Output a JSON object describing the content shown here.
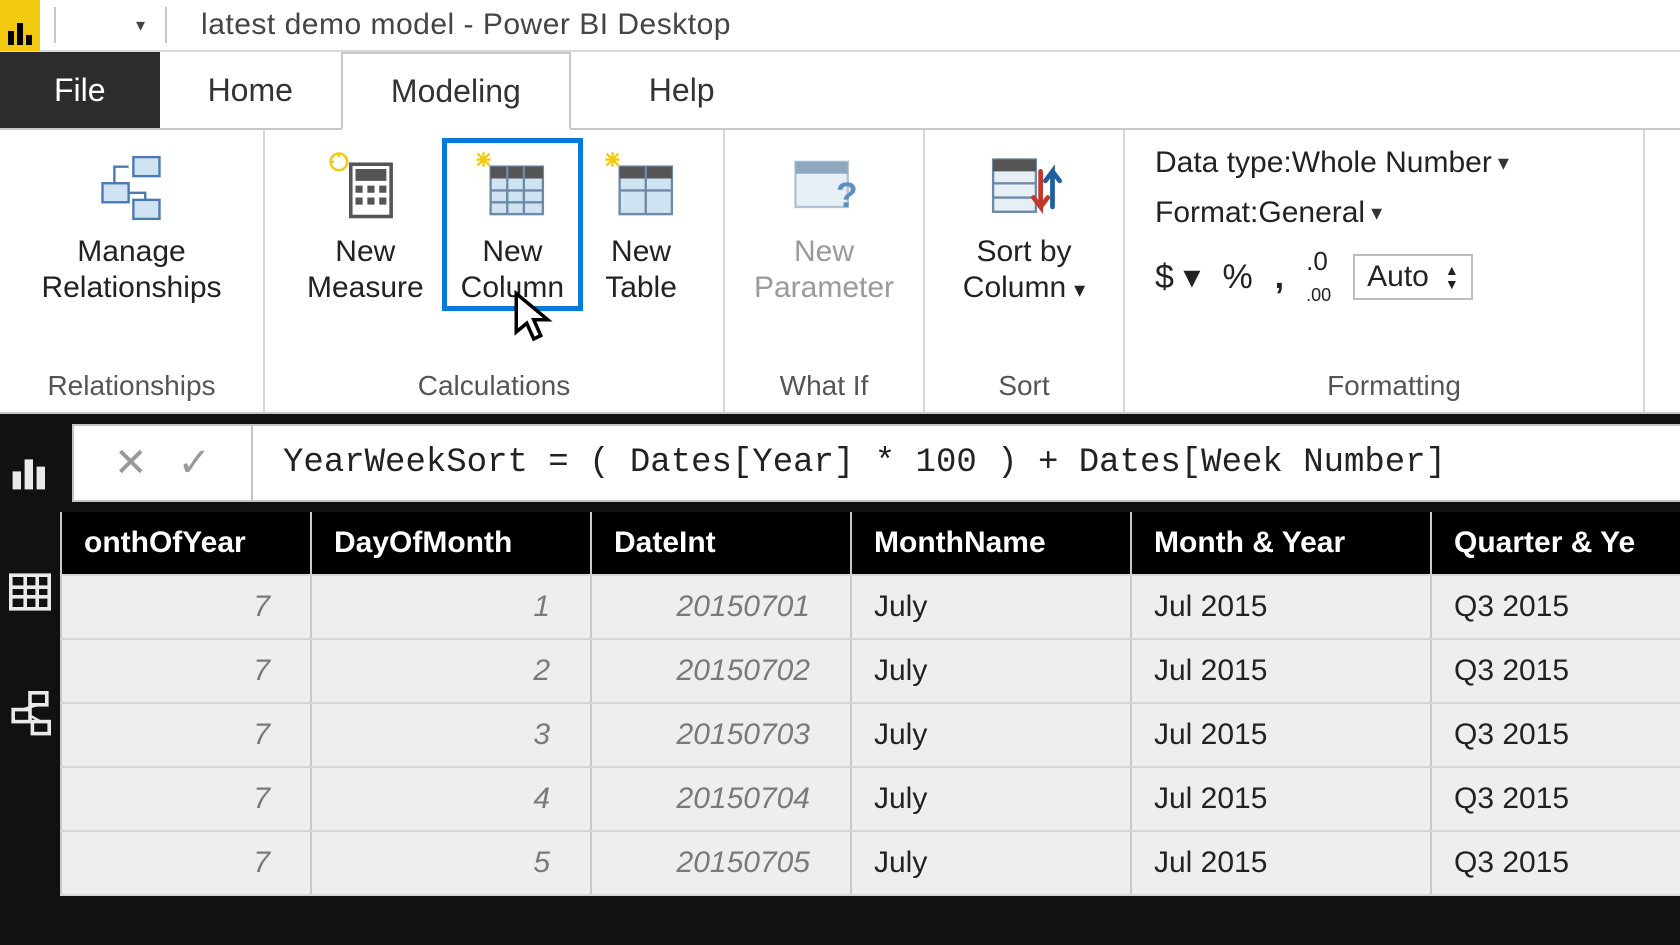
{
  "title": "latest demo model - Power BI Desktop",
  "tabs": {
    "file": "File",
    "home": "Home",
    "modeling": "Modeling",
    "help": "Help"
  },
  "ribbon": {
    "relationships": {
      "manage": "Manage\nRelationships",
      "group": "Relationships"
    },
    "calculations": {
      "measure": "New\nMeasure",
      "column": "New\nColumn",
      "table": "New\nTable",
      "group": "Calculations"
    },
    "whatif": {
      "parameter": "New\nParameter",
      "group": "What If"
    },
    "sort": {
      "sortby": "Sort by\nColumn",
      "group": "Sort"
    },
    "formatting": {
      "datatype_label": "Data type: ",
      "datatype_value": "Whole Number",
      "format_label": "Format: ",
      "format_value": "General",
      "auto": "Auto",
      "group": "Formatting"
    }
  },
  "formula": "YearWeekSort = ( Dates[Year] * 100 ) + Dates[Week Number]",
  "columns": [
    "onthOfYear",
    "DayOfMonth",
    "DateInt",
    "MonthName",
    "Month & Year",
    "Quarter & Ye"
  ],
  "rows": [
    {
      "m": 7,
      "d": 1,
      "di": "20150701",
      "mn": "July",
      "my": "Jul 2015",
      "qy": "Q3 2015"
    },
    {
      "m": 7,
      "d": 2,
      "di": "20150702",
      "mn": "July",
      "my": "Jul 2015",
      "qy": "Q3 2015"
    },
    {
      "m": 7,
      "d": 3,
      "di": "20150703",
      "mn": "July",
      "my": "Jul 2015",
      "qy": "Q3 2015"
    },
    {
      "m": 7,
      "d": 4,
      "di": "20150704",
      "mn": "July",
      "my": "Jul 2015",
      "qy": "Q3 2015"
    },
    {
      "m": 7,
      "d": 5,
      "di": "20150705",
      "mn": "July",
      "my": "Jul 2015",
      "qy": "Q3 2015"
    }
  ]
}
